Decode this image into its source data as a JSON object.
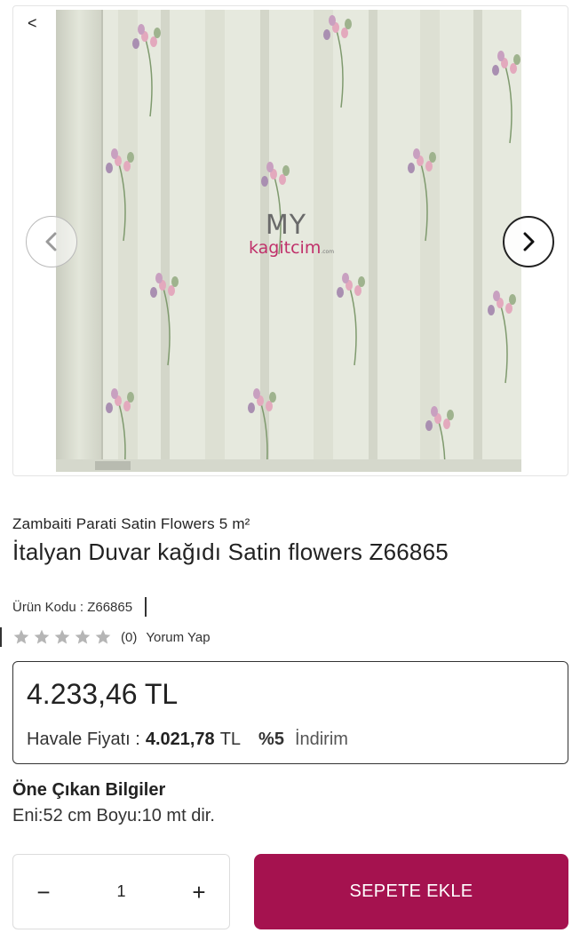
{
  "colors": {
    "accent": "#a5124f",
    "star": "#b5b5b5",
    "text": "#222222",
    "wallpaper_base": "#e6e9de",
    "wallpaper_stripe": "#d9dccf"
  },
  "nav": {
    "back_label": "<"
  },
  "gallery": {
    "watermark_main": "MY",
    "watermark_sub": "kagitcim",
    "watermark_suffix": ".com",
    "prev_icon": "chevron-left-icon",
    "next_icon": "chevron-right-icon"
  },
  "product": {
    "subtitle": "Zambaiti Parati Satin Flowers 5 m²",
    "title": "İtalyan Duvar kağıdı Satin flowers Z66865",
    "code_text": "Ürün Kodu : Z66865"
  },
  "rating": {
    "stars_total": 5,
    "stars_filled": 0,
    "count": "(0)",
    "review_link": "Yorum Yap"
  },
  "price": {
    "main": "4.233,46 TL",
    "transfer_label": "Havale Fiyatı :",
    "transfer_value": "4.021,78",
    "transfer_currency": "TL",
    "discount_pct": "%5",
    "discount_label": "İndirim"
  },
  "highlights": {
    "title": "Öne Çıkan Bilgiler",
    "text": "Eni:52 cm Boyu:10 mt dir."
  },
  "cart": {
    "minus": "−",
    "plus": "+",
    "quantity": "1",
    "add_label": "SEPETE EKLE"
  }
}
